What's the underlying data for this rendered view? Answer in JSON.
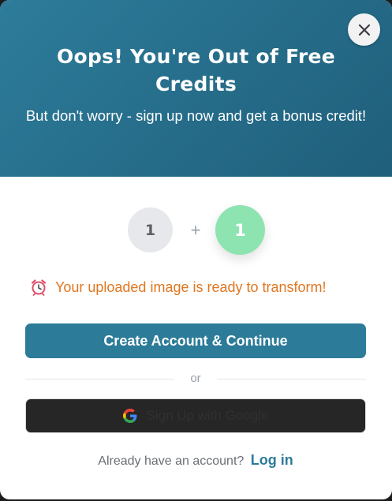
{
  "modal": {
    "title": "Oops! You're Out of Free Credits",
    "subtitle": "But don't worry - sign up now and get a bonus credit!",
    "close_icon": "close-icon"
  },
  "credits": {
    "current": "1",
    "plus": "+",
    "bonus": "1"
  },
  "status": {
    "icon": "alarm-clock-icon",
    "message": "Your uploaded image is ready to transform!"
  },
  "actions": {
    "create_account_label": "Create Account & Continue",
    "divider_text": "or",
    "google_label": "Sign Up with Google",
    "google_icon": "google-icon",
    "login_prompt": "Already have an account?",
    "login_label": "Log in"
  },
  "colors": {
    "header_bg": "#2d7c9a",
    "primary": "#2c7b99",
    "bonus_green": "#8ee4b1",
    "message_orange": "#e0761f"
  }
}
